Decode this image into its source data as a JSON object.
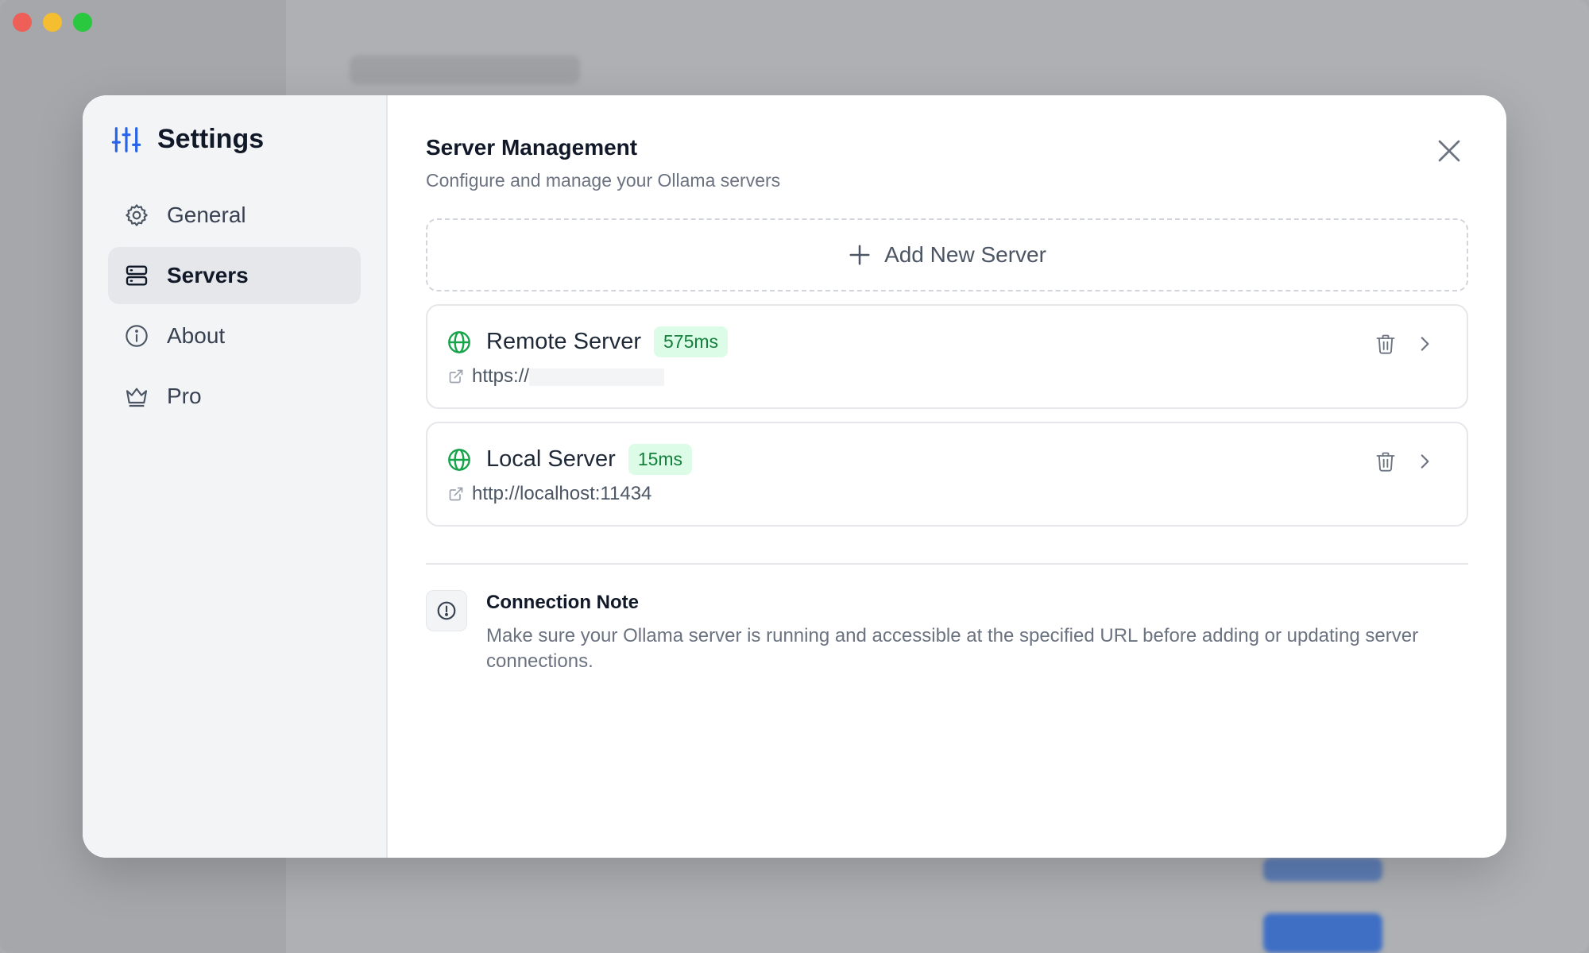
{
  "sidebar": {
    "title": "Settings",
    "items": [
      {
        "label": "General",
        "icon": "gear-icon",
        "active": false
      },
      {
        "label": "Servers",
        "icon": "server-icon",
        "active": true
      },
      {
        "label": "About",
        "icon": "info-icon",
        "active": false
      },
      {
        "label": "Pro",
        "icon": "crown-icon",
        "active": false
      }
    ]
  },
  "main": {
    "title": "Server Management",
    "subtitle": "Configure and manage your Ollama servers",
    "add_label": "Add New Server",
    "servers": [
      {
        "name": "Remote Server",
        "latency": "575ms",
        "url": "https://"
      },
      {
        "name": "Local Server",
        "latency": "15ms",
        "url": "http://localhost:11434"
      }
    ],
    "note": {
      "title": "Connection Note",
      "text": "Make sure your Ollama server is running and accessible at the specified URL before adding or updating server connections."
    }
  },
  "colors": {
    "accent": "#2563eb",
    "status_green": "#16a34a",
    "latency_bg": "#dcfce7"
  }
}
